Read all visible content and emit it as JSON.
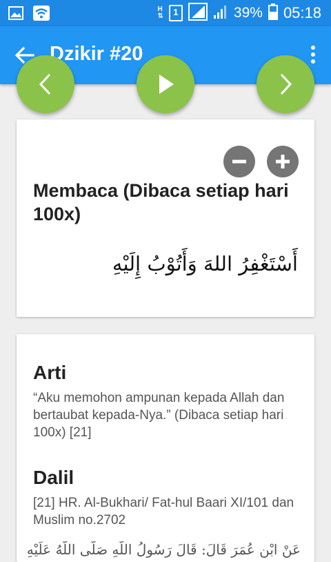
{
  "status_bar": {
    "network_label": "H",
    "sim_label": "1",
    "battery": "39%",
    "time": "05:18"
  },
  "app_bar": {
    "title": "Dzikir #20"
  },
  "reading_card": {
    "title": "Membaca (Dibaca setiap hari 100x)",
    "arabic": "أَسْتَغْفِرُ اللهَ وَأَتُوْبُ إِلَيْهِ"
  },
  "info_card": {
    "arti_heading": "Arti",
    "arti_text": "“Aku memohon ampunan kepada Allah dan bertaubat kepada-Nya.” (Dibaca setiap hari 100x) [21]",
    "dalil_heading": "Dalil",
    "dalil_text": "[21] HR. Al-Bukhari/ Fat-hul Baari XI/101 dan Muslim no.2702",
    "dalil_arabic": "عَنْ ابْنِ عُمَرَ قَالَ: قَالَ رَسُولُ اللَّهِ صَلَّى اللَّهُ عَلَيْهِ"
  },
  "colors": {
    "status_bar": "#1e88e5",
    "app_bar": "#2196f3",
    "fab": "#8bc34a",
    "zoom_button": "#757575"
  }
}
